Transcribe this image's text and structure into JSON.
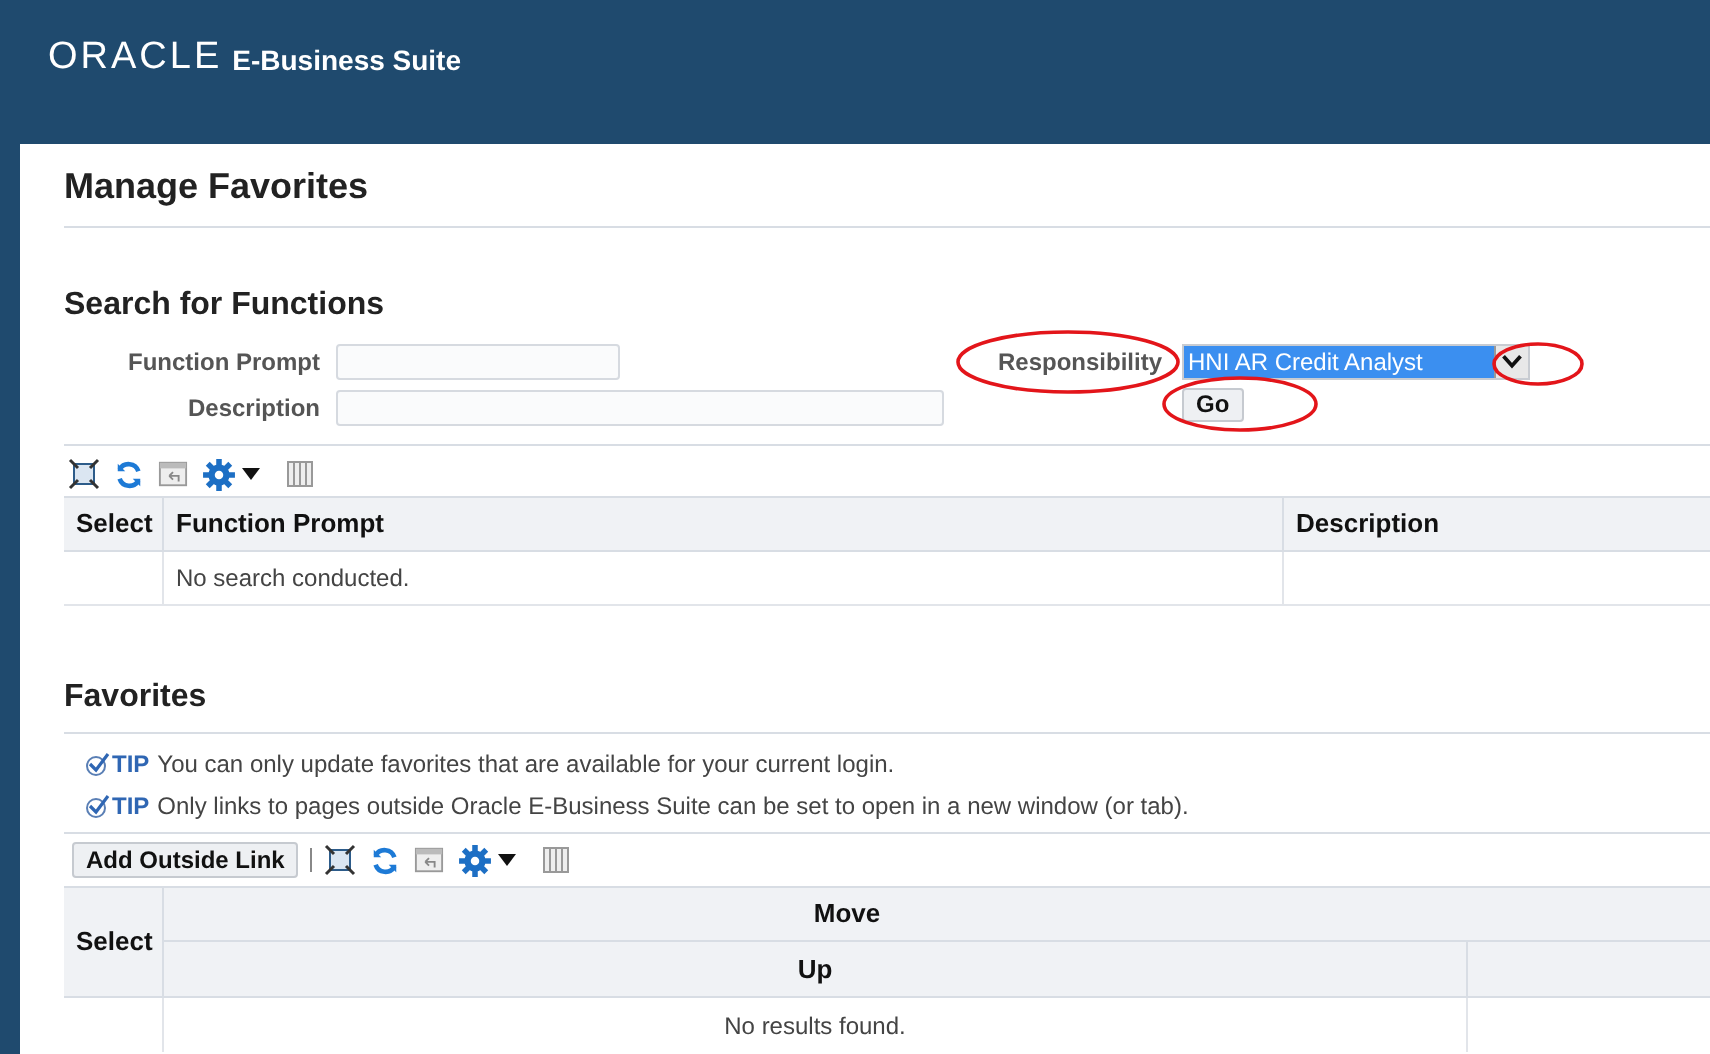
{
  "header": {
    "logo": "ORACLE",
    "product": "E-Business Suite"
  },
  "page_title": "Manage Favorites",
  "search": {
    "title": "Search for Functions",
    "fields": [
      {
        "label": "Function Prompt",
        "kind": "short"
      },
      {
        "label": "Description",
        "kind": "long"
      }
    ],
    "responsibility": {
      "label": "Responsibility",
      "value": "HNI AR Credit Analyst",
      "highlighted": true
    },
    "go_button": "Go",
    "table": {
      "columns": [
        "Select",
        "Function Prompt",
        "Description"
      ],
      "empty_message": "No search conducted."
    }
  },
  "favorites": {
    "title": "Favorites",
    "tips": [
      {
        "tag": "TIP",
        "text": "You can only update favorites that are available for your current login."
      },
      {
        "tag": "TIP",
        "text": "Only links to pages outside Oracle E-Business Suite can be set to open in a new window (or tab)."
      }
    ],
    "add_button": "Add Outside Link",
    "table": {
      "select_column": "Select",
      "group_column": "Move",
      "sub_column": "Up",
      "empty_message": "No results found."
    }
  }
}
